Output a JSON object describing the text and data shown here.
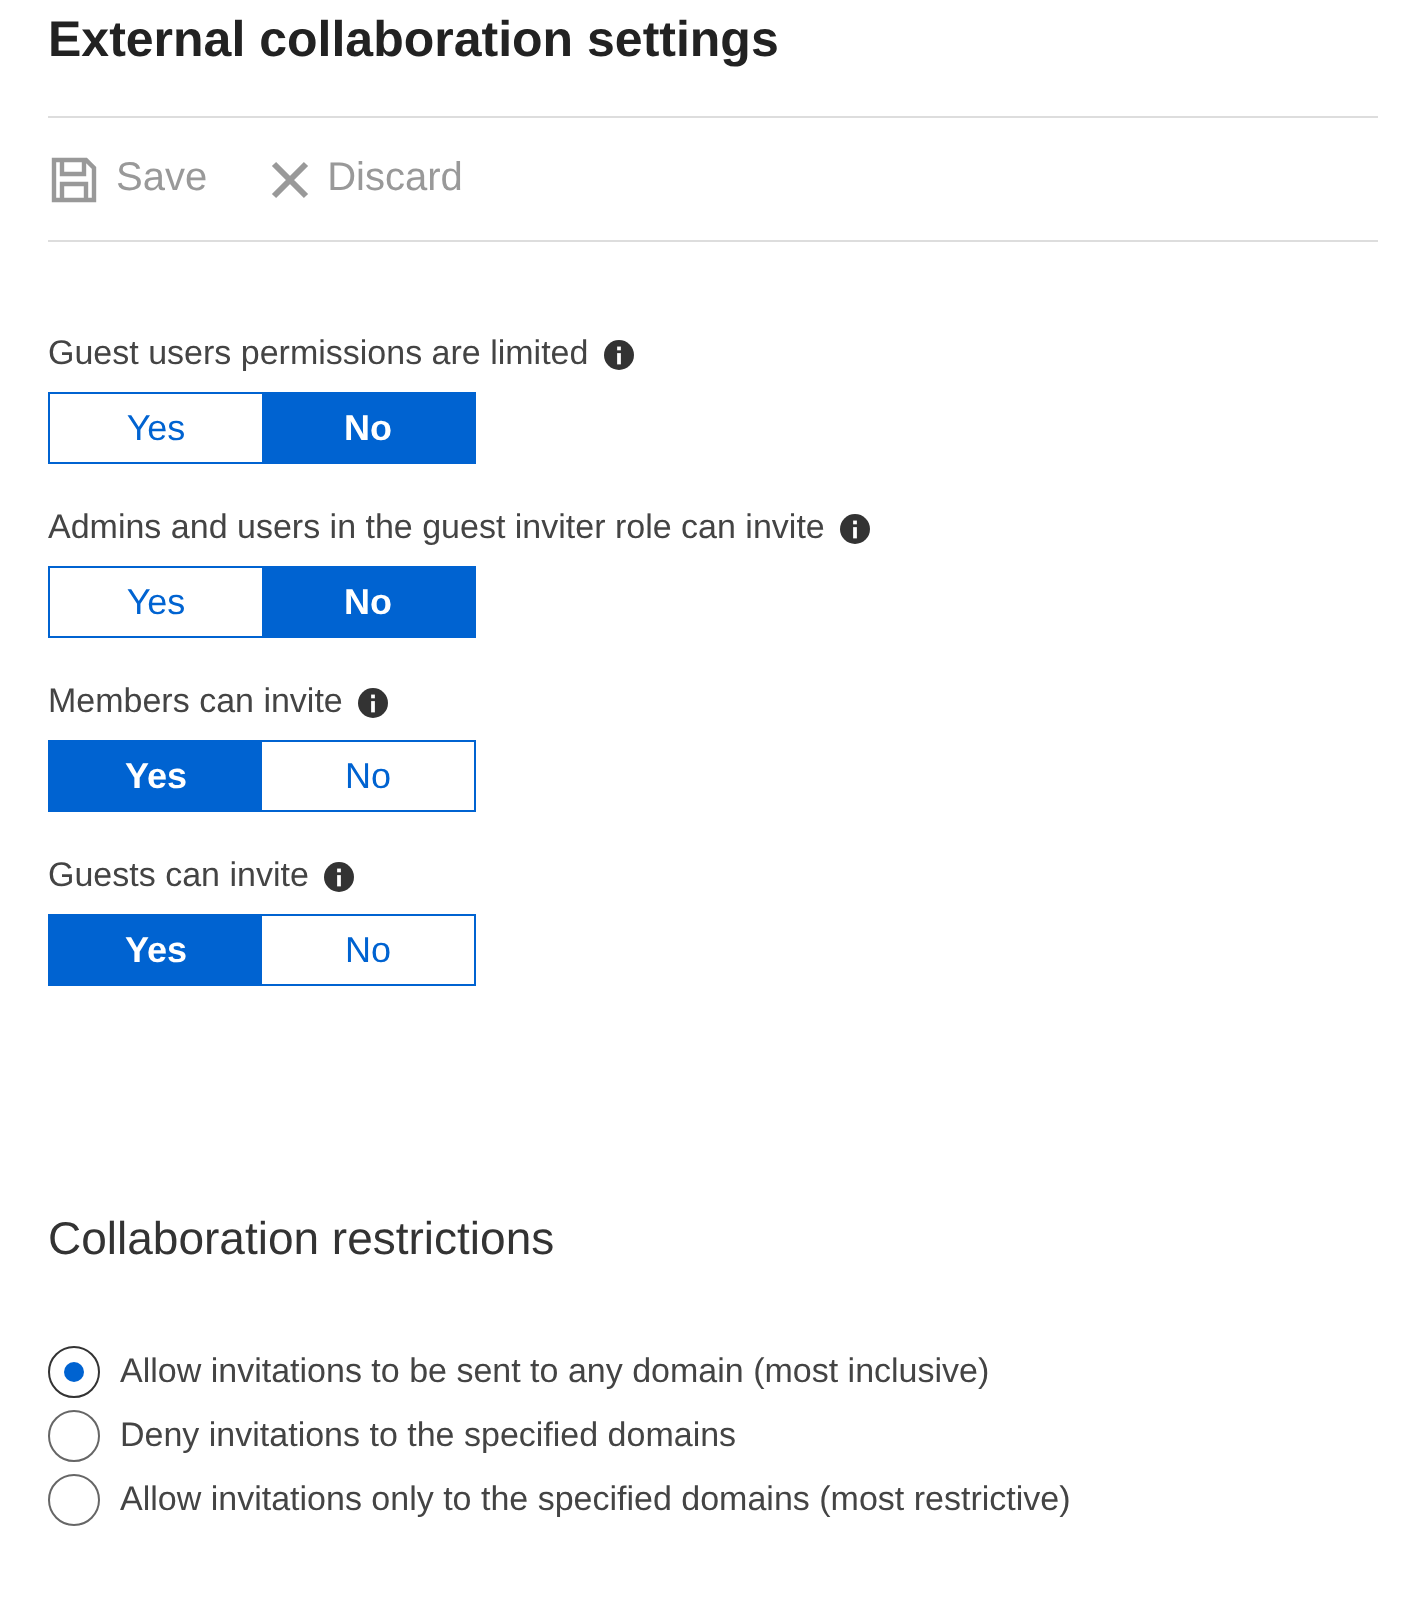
{
  "title": "External collaboration settings",
  "toolbar": [
    {
      "kind": "save",
      "label": "Save",
      "disabled": true
    },
    {
      "kind": "discard",
      "label": "Discard",
      "disabled": true
    }
  ],
  "settings": [
    {
      "label": "Guest users permissions are limited",
      "options": [
        {
          "label": "Yes",
          "selected": false
        },
        {
          "label": "No",
          "selected": true
        }
      ]
    },
    {
      "label": "Admins and users in the guest inviter role can invite",
      "options": [
        {
          "label": "Yes",
          "selected": false
        },
        {
          "label": "No",
          "selected": true
        }
      ]
    },
    {
      "label": "Members can invite",
      "options": [
        {
          "label": "Yes",
          "selected": true
        },
        {
          "label": "No",
          "selected": false
        }
      ]
    },
    {
      "label": "Guests can invite",
      "options": [
        {
          "label": "Yes",
          "selected": true
        },
        {
          "label": "No",
          "selected": false
        }
      ]
    }
  ],
  "restrictions": {
    "heading": "Collaboration restrictions",
    "options": [
      {
        "label": "Allow invitations to be sent to any domain (most inclusive)",
        "selected": true
      },
      {
        "label": "Deny invitations to the specified domains",
        "selected": false
      },
      {
        "label": "Allow invitations only to the specified domains (most restrictive)",
        "selected": false
      }
    ]
  }
}
